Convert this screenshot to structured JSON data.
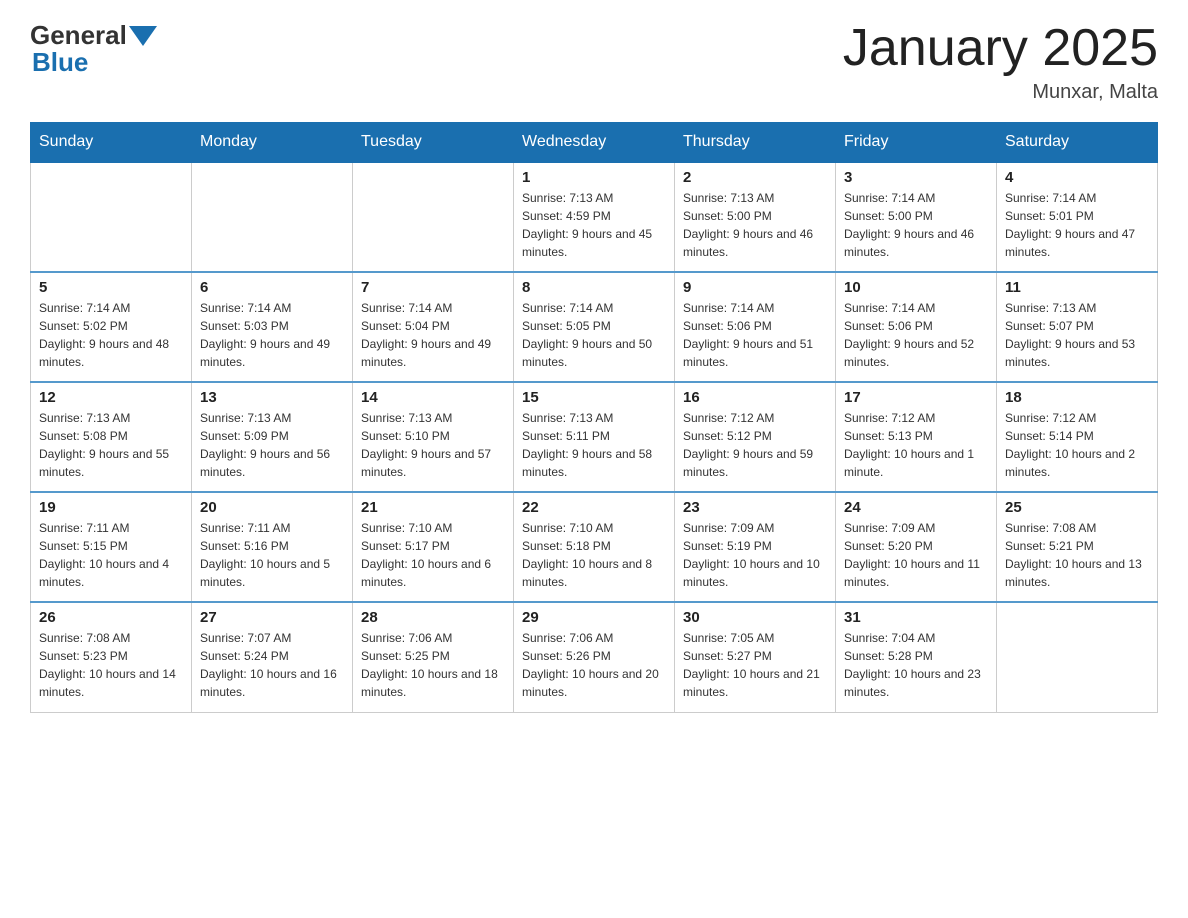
{
  "header": {
    "title": "January 2025",
    "location": "Munxar, Malta",
    "logo_general": "General",
    "logo_blue": "Blue"
  },
  "days_of_week": [
    "Sunday",
    "Monday",
    "Tuesday",
    "Wednesday",
    "Thursday",
    "Friday",
    "Saturday"
  ],
  "weeks": [
    [
      {
        "day": "",
        "sunrise": "",
        "sunset": "",
        "daylight": ""
      },
      {
        "day": "",
        "sunrise": "",
        "sunset": "",
        "daylight": ""
      },
      {
        "day": "",
        "sunrise": "",
        "sunset": "",
        "daylight": ""
      },
      {
        "day": "1",
        "sunrise": "Sunrise: 7:13 AM",
        "sunset": "Sunset: 4:59 PM",
        "daylight": "Daylight: 9 hours and 45 minutes."
      },
      {
        "day": "2",
        "sunrise": "Sunrise: 7:13 AM",
        "sunset": "Sunset: 5:00 PM",
        "daylight": "Daylight: 9 hours and 46 minutes."
      },
      {
        "day": "3",
        "sunrise": "Sunrise: 7:14 AM",
        "sunset": "Sunset: 5:00 PM",
        "daylight": "Daylight: 9 hours and 46 minutes."
      },
      {
        "day": "4",
        "sunrise": "Sunrise: 7:14 AM",
        "sunset": "Sunset: 5:01 PM",
        "daylight": "Daylight: 9 hours and 47 minutes."
      }
    ],
    [
      {
        "day": "5",
        "sunrise": "Sunrise: 7:14 AM",
        "sunset": "Sunset: 5:02 PM",
        "daylight": "Daylight: 9 hours and 48 minutes."
      },
      {
        "day": "6",
        "sunrise": "Sunrise: 7:14 AM",
        "sunset": "Sunset: 5:03 PM",
        "daylight": "Daylight: 9 hours and 49 minutes."
      },
      {
        "day": "7",
        "sunrise": "Sunrise: 7:14 AM",
        "sunset": "Sunset: 5:04 PM",
        "daylight": "Daylight: 9 hours and 49 minutes."
      },
      {
        "day": "8",
        "sunrise": "Sunrise: 7:14 AM",
        "sunset": "Sunset: 5:05 PM",
        "daylight": "Daylight: 9 hours and 50 minutes."
      },
      {
        "day": "9",
        "sunrise": "Sunrise: 7:14 AM",
        "sunset": "Sunset: 5:06 PM",
        "daylight": "Daylight: 9 hours and 51 minutes."
      },
      {
        "day": "10",
        "sunrise": "Sunrise: 7:14 AM",
        "sunset": "Sunset: 5:06 PM",
        "daylight": "Daylight: 9 hours and 52 minutes."
      },
      {
        "day": "11",
        "sunrise": "Sunrise: 7:13 AM",
        "sunset": "Sunset: 5:07 PM",
        "daylight": "Daylight: 9 hours and 53 minutes."
      }
    ],
    [
      {
        "day": "12",
        "sunrise": "Sunrise: 7:13 AM",
        "sunset": "Sunset: 5:08 PM",
        "daylight": "Daylight: 9 hours and 55 minutes."
      },
      {
        "day": "13",
        "sunrise": "Sunrise: 7:13 AM",
        "sunset": "Sunset: 5:09 PM",
        "daylight": "Daylight: 9 hours and 56 minutes."
      },
      {
        "day": "14",
        "sunrise": "Sunrise: 7:13 AM",
        "sunset": "Sunset: 5:10 PM",
        "daylight": "Daylight: 9 hours and 57 minutes."
      },
      {
        "day": "15",
        "sunrise": "Sunrise: 7:13 AM",
        "sunset": "Sunset: 5:11 PM",
        "daylight": "Daylight: 9 hours and 58 minutes."
      },
      {
        "day": "16",
        "sunrise": "Sunrise: 7:12 AM",
        "sunset": "Sunset: 5:12 PM",
        "daylight": "Daylight: 9 hours and 59 minutes."
      },
      {
        "day": "17",
        "sunrise": "Sunrise: 7:12 AM",
        "sunset": "Sunset: 5:13 PM",
        "daylight": "Daylight: 10 hours and 1 minute."
      },
      {
        "day": "18",
        "sunrise": "Sunrise: 7:12 AM",
        "sunset": "Sunset: 5:14 PM",
        "daylight": "Daylight: 10 hours and 2 minutes."
      }
    ],
    [
      {
        "day": "19",
        "sunrise": "Sunrise: 7:11 AM",
        "sunset": "Sunset: 5:15 PM",
        "daylight": "Daylight: 10 hours and 4 minutes."
      },
      {
        "day": "20",
        "sunrise": "Sunrise: 7:11 AM",
        "sunset": "Sunset: 5:16 PM",
        "daylight": "Daylight: 10 hours and 5 minutes."
      },
      {
        "day": "21",
        "sunrise": "Sunrise: 7:10 AM",
        "sunset": "Sunset: 5:17 PM",
        "daylight": "Daylight: 10 hours and 6 minutes."
      },
      {
        "day": "22",
        "sunrise": "Sunrise: 7:10 AM",
        "sunset": "Sunset: 5:18 PM",
        "daylight": "Daylight: 10 hours and 8 minutes."
      },
      {
        "day": "23",
        "sunrise": "Sunrise: 7:09 AM",
        "sunset": "Sunset: 5:19 PM",
        "daylight": "Daylight: 10 hours and 10 minutes."
      },
      {
        "day": "24",
        "sunrise": "Sunrise: 7:09 AM",
        "sunset": "Sunset: 5:20 PM",
        "daylight": "Daylight: 10 hours and 11 minutes."
      },
      {
        "day": "25",
        "sunrise": "Sunrise: 7:08 AM",
        "sunset": "Sunset: 5:21 PM",
        "daylight": "Daylight: 10 hours and 13 minutes."
      }
    ],
    [
      {
        "day": "26",
        "sunrise": "Sunrise: 7:08 AM",
        "sunset": "Sunset: 5:23 PM",
        "daylight": "Daylight: 10 hours and 14 minutes."
      },
      {
        "day": "27",
        "sunrise": "Sunrise: 7:07 AM",
        "sunset": "Sunset: 5:24 PM",
        "daylight": "Daylight: 10 hours and 16 minutes."
      },
      {
        "day": "28",
        "sunrise": "Sunrise: 7:06 AM",
        "sunset": "Sunset: 5:25 PM",
        "daylight": "Daylight: 10 hours and 18 minutes."
      },
      {
        "day": "29",
        "sunrise": "Sunrise: 7:06 AM",
        "sunset": "Sunset: 5:26 PM",
        "daylight": "Daylight: 10 hours and 20 minutes."
      },
      {
        "day": "30",
        "sunrise": "Sunrise: 7:05 AM",
        "sunset": "Sunset: 5:27 PM",
        "daylight": "Daylight: 10 hours and 21 minutes."
      },
      {
        "day": "31",
        "sunrise": "Sunrise: 7:04 AM",
        "sunset": "Sunset: 5:28 PM",
        "daylight": "Daylight: 10 hours and 23 minutes."
      },
      {
        "day": "",
        "sunrise": "",
        "sunset": "",
        "daylight": ""
      }
    ]
  ]
}
